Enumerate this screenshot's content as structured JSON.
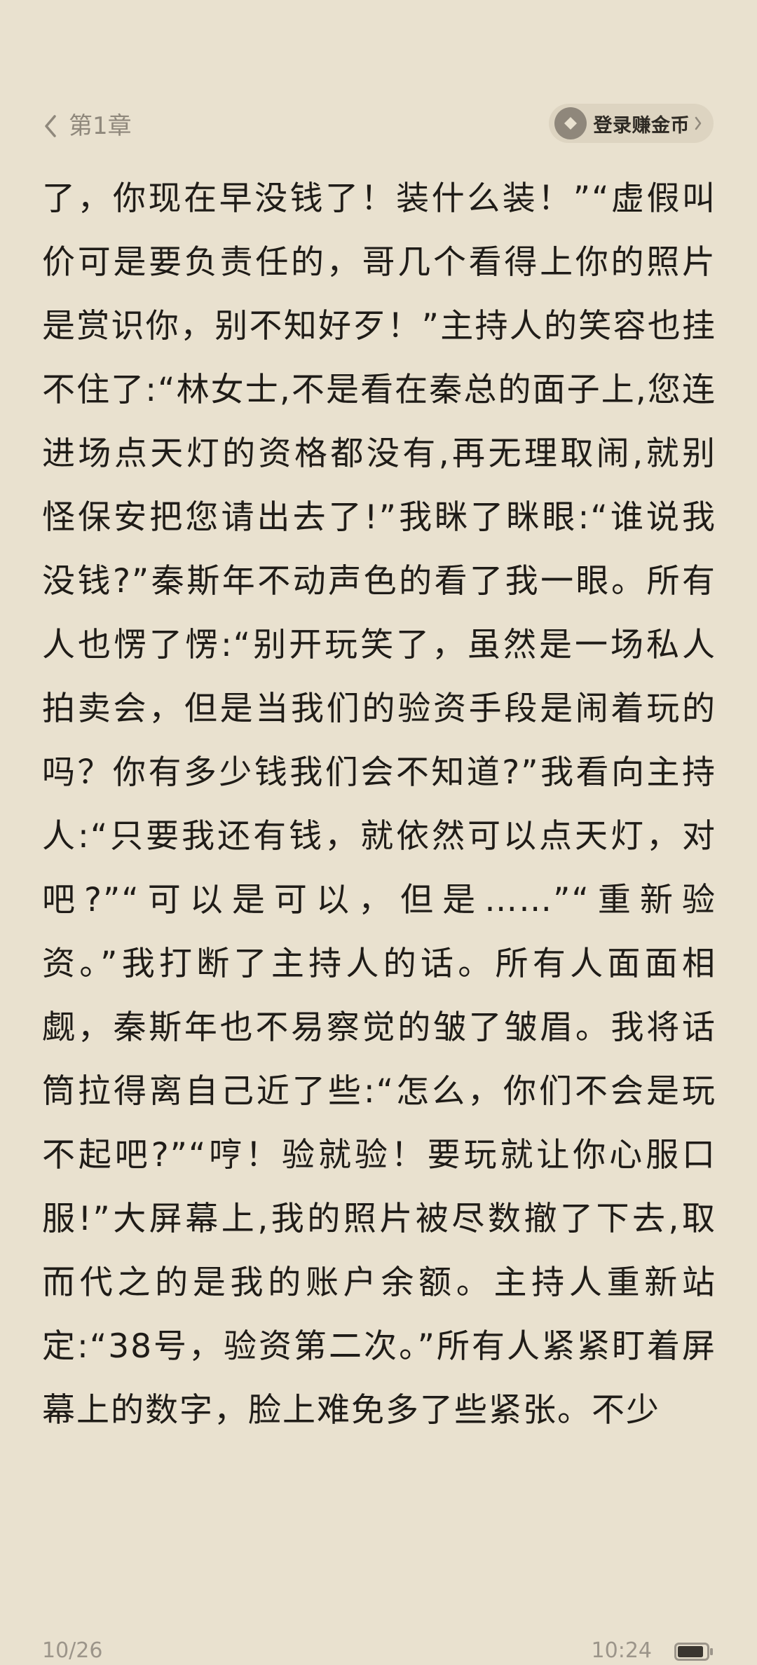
{
  "header": {
    "chapter_title": "第1章",
    "coin_button_label": "登录赚金币",
    "icons": {
      "back": "chevron-left-icon",
      "coin": "diamond-coin-icon",
      "more": "chevron-right-icon"
    }
  },
  "reader": {
    "text": "了，你现在早没钱了！装什么装！”“虚假叫价可是要负责任的，哥几个看得上你的照片是赏识你，别不知好歹！”主持人的笑容也挂不住了:“林女士,不是看在秦总的面子上,您连进场点天灯的资格都没有,再无理取闹,就别怪保安把您请出去了!”我眯了眯眼:“谁说我没钱?”秦斯年不动声色的看了我一眼。所有人也愣了愣:“别开玩笑了，虽然是一场私人拍卖会，但是当我们的验资手段是闹着玩的吗？你有多少钱我们会不知道?”我看向主持人:“只要我还有钱，就依然可以点天灯，对吧?”“可以是可以，但是……”“重新验资。”我打断了主持人的话。所有人面面相觑，秦斯年也不易察觉的皱了皱眉。我将话筒拉得离自己近了些:“怎么，你们不会是玩不起吧?”“哼！验就验！要玩就让你心服口服!”大屏幕上,我的照片被尽数撤了下去,取而代之的是我的账户余额。主持人重新站定:“38号，验资第二次。”所有人紧紧盯着屏幕上的数字，脸上难免多了些紧张。不少"
  },
  "footer": {
    "page_progress": "10/26",
    "time": "10:24",
    "battery_level": 0.9,
    "icons": {
      "battery": "battery-icon"
    }
  },
  "colors": {
    "background": "#e9e1cf",
    "text": "#1f1c18",
    "muted": "#9c958a",
    "pill": "#ddd4c1"
  }
}
